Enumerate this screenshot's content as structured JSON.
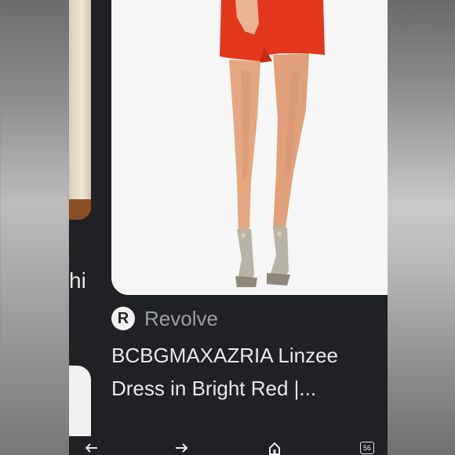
{
  "previous_card": {
    "caption_fragment": "hi"
  },
  "result": {
    "source_logo_letter": "R",
    "source_name": "Revolve",
    "title": "BCBGMAXAZRIA Linzee Dress in Bright Red |..."
  },
  "bottom_nav": {
    "tab_count": "56",
    "icons": [
      "back-arrow-icon",
      "forward-arrow-icon",
      "home-icon",
      "tab-switcher-icon"
    ]
  },
  "colors": {
    "screen_bg": "#202124",
    "dress_red": "#e3371c",
    "text_primary": "#e8eaed",
    "text_secondary": "#9aa0a6"
  }
}
